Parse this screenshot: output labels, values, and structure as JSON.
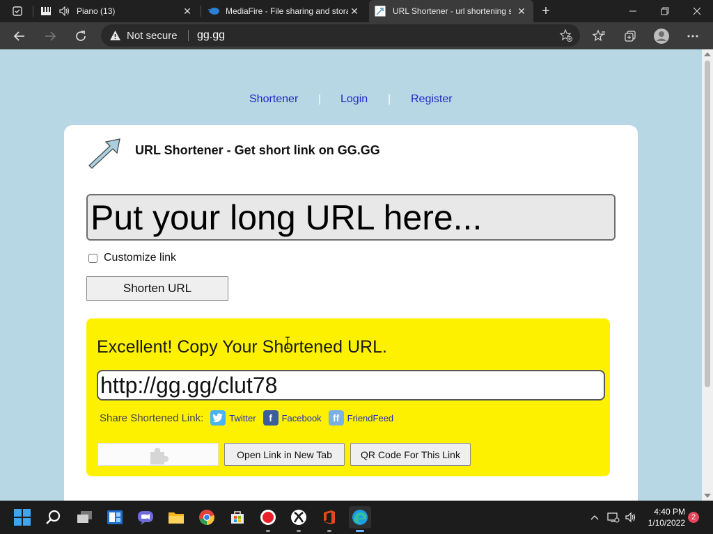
{
  "browser": {
    "tabs": [
      {
        "label": "Piano (13)",
        "icon": "piano-icon",
        "audio": true,
        "active": false
      },
      {
        "label": "MediaFire - File sharing and storage",
        "icon": "mediafire-icon",
        "active": false
      },
      {
        "label": "URL Shortener - url shortening service",
        "icon": "gggg-arrow-icon",
        "active": true
      }
    ],
    "address": {
      "security_label": "Not secure",
      "url": "gg.gg"
    }
  },
  "page": {
    "nav": {
      "shortener": "Shortener",
      "login": "Login",
      "register": "Register",
      "separator": "|"
    },
    "title": "URL Shortener - Get short link on GG.GG",
    "long_url_placeholder": "Put your long URL here...",
    "customize_label": "Customize link",
    "customize_checked": false,
    "shorten_button": "Shorten URL",
    "result": {
      "heading": "Excellent! Copy Your Shortened URL.",
      "short_url": "http://gg.gg/clut78",
      "share_label": "Share Shortened Link:",
      "share": {
        "twitter": "Twitter",
        "facebook": "Facebook",
        "friendfeed": "FriendFeed"
      },
      "open_button": "Open Link in New Tab",
      "qr_button": "QR Code For This Link"
    }
  },
  "taskbar": {
    "apps": [
      "start",
      "search",
      "task-view",
      "widgets",
      "teams-chat",
      "file-explorer",
      "chrome",
      "microsoft-store",
      "screen-recorder",
      "xbox",
      "office",
      "edge"
    ],
    "time": "4:40 PM",
    "date": "1/10/2022",
    "notification_count": "2"
  },
  "colors": {
    "page_background": "#b7d7e5",
    "result_background": "#fdf100",
    "link_color": "#1f29c6"
  }
}
